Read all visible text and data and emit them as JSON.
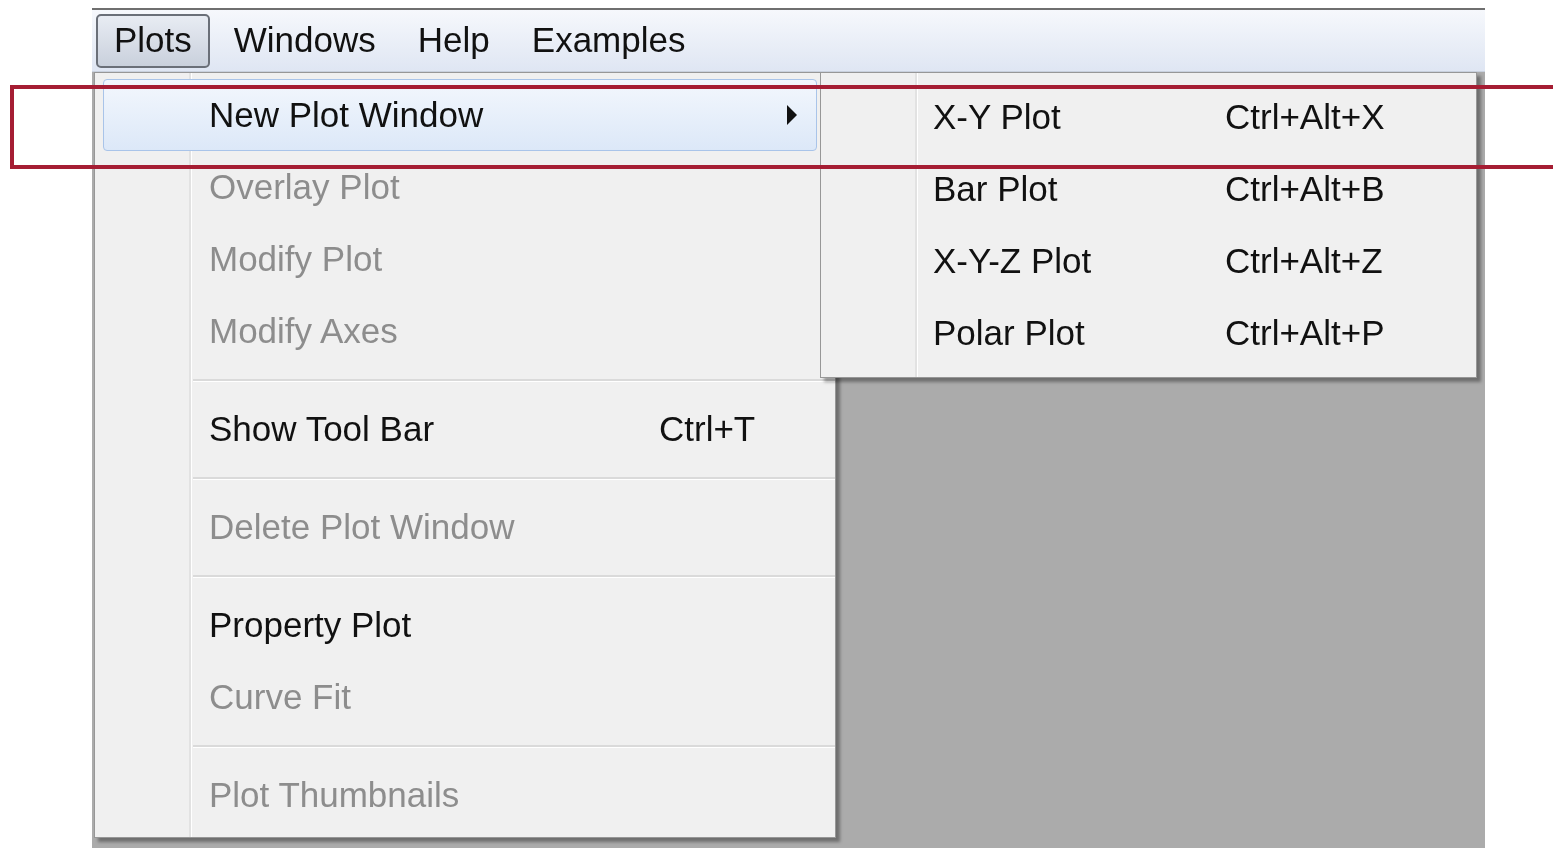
{
  "menubar": [
    {
      "label": "Plots",
      "selected": true
    },
    {
      "label": "Windows",
      "selected": false
    },
    {
      "label": "Help",
      "selected": false
    },
    {
      "label": "Examples",
      "selected": false
    }
  ],
  "menu": {
    "items": [
      {
        "kind": "item",
        "label": "New Plot Window",
        "selected": true,
        "disabled": false,
        "submenu": true
      },
      {
        "kind": "item",
        "label": "Overlay Plot",
        "selected": false,
        "disabled": true,
        "submenu": false
      },
      {
        "kind": "item",
        "label": "Modify Plot",
        "selected": false,
        "disabled": true,
        "submenu": false
      },
      {
        "kind": "item",
        "label": "Modify Axes",
        "selected": false,
        "disabled": true,
        "submenu": false
      },
      {
        "kind": "separator"
      },
      {
        "kind": "item",
        "label": "Show Tool Bar",
        "shortcut": "Ctrl+T",
        "selected": false,
        "disabled": false,
        "submenu": false
      },
      {
        "kind": "separator"
      },
      {
        "kind": "item",
        "label": "Delete Plot Window",
        "selected": false,
        "disabled": true,
        "submenu": false
      },
      {
        "kind": "separator"
      },
      {
        "kind": "item",
        "label": "Property Plot",
        "selected": false,
        "disabled": false,
        "submenu": false
      },
      {
        "kind": "item",
        "label": "Curve Fit",
        "selected": false,
        "disabled": true,
        "submenu": false
      },
      {
        "kind": "separator"
      },
      {
        "kind": "item",
        "label": "Plot Thumbnails",
        "selected": false,
        "disabled": true,
        "submenu": false
      }
    ]
  },
  "submenu": {
    "items": [
      {
        "label": "X-Y Plot",
        "shortcut": "Ctrl+Alt+X"
      },
      {
        "label": "Bar Plot",
        "shortcut": "Ctrl+Alt+B"
      },
      {
        "label": "X-Y-Z Plot",
        "shortcut": "Ctrl+Alt+Z"
      },
      {
        "label": "Polar Plot",
        "shortcut": "Ctrl+Alt+P"
      }
    ]
  }
}
